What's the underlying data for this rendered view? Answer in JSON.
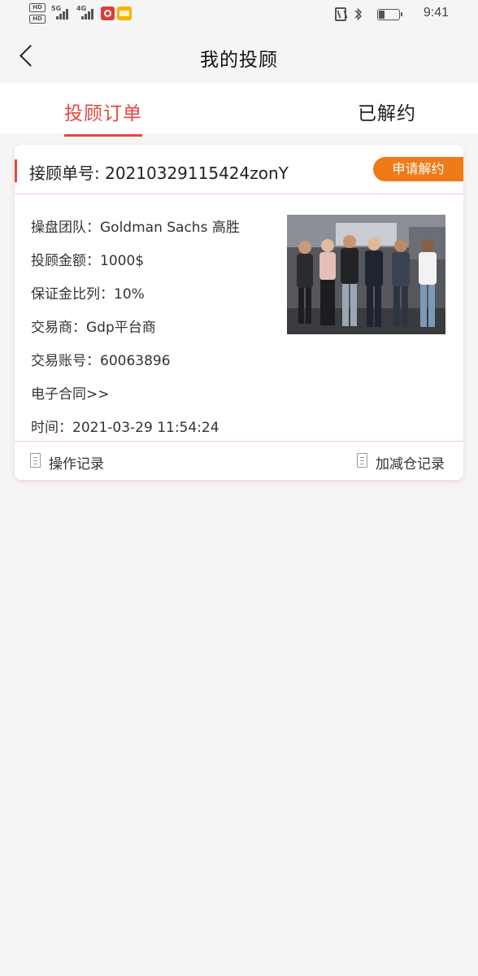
{
  "status_bar": {
    "left_badges": [
      "HD",
      "HD"
    ],
    "net_1": "5G",
    "net_2": "4G",
    "time": "9:41",
    "battery_level": 0.3
  },
  "nav": {
    "title": "我的投顾",
    "back_icon": "chevron-left-icon"
  },
  "tabs": [
    {
      "label": "投顾订单",
      "active": true
    },
    {
      "label": "已解约",
      "active": false
    }
  ],
  "order": {
    "order_no": "接顾单号: 20210329115424zonY",
    "cancel_label": "申请解约",
    "details": [
      "操盘团队：Goldman Sachs 高胜",
      "投顾金额：1000$",
      "保证金比列：10%",
      "交易商：Gdp平台商",
      "交易账号：60063896"
    ],
    "contract_link": "电子合同>>",
    "time": "时间：2021-03-29 11:54:24",
    "photo": "team-photo",
    "footer": {
      "ops_log": "操作记录",
      "position_log": "加减仓记录"
    }
  },
  "colors": {
    "accent": "#e3473f",
    "cancel_button": "#ee7a18",
    "background": "#f5f5f5"
  }
}
